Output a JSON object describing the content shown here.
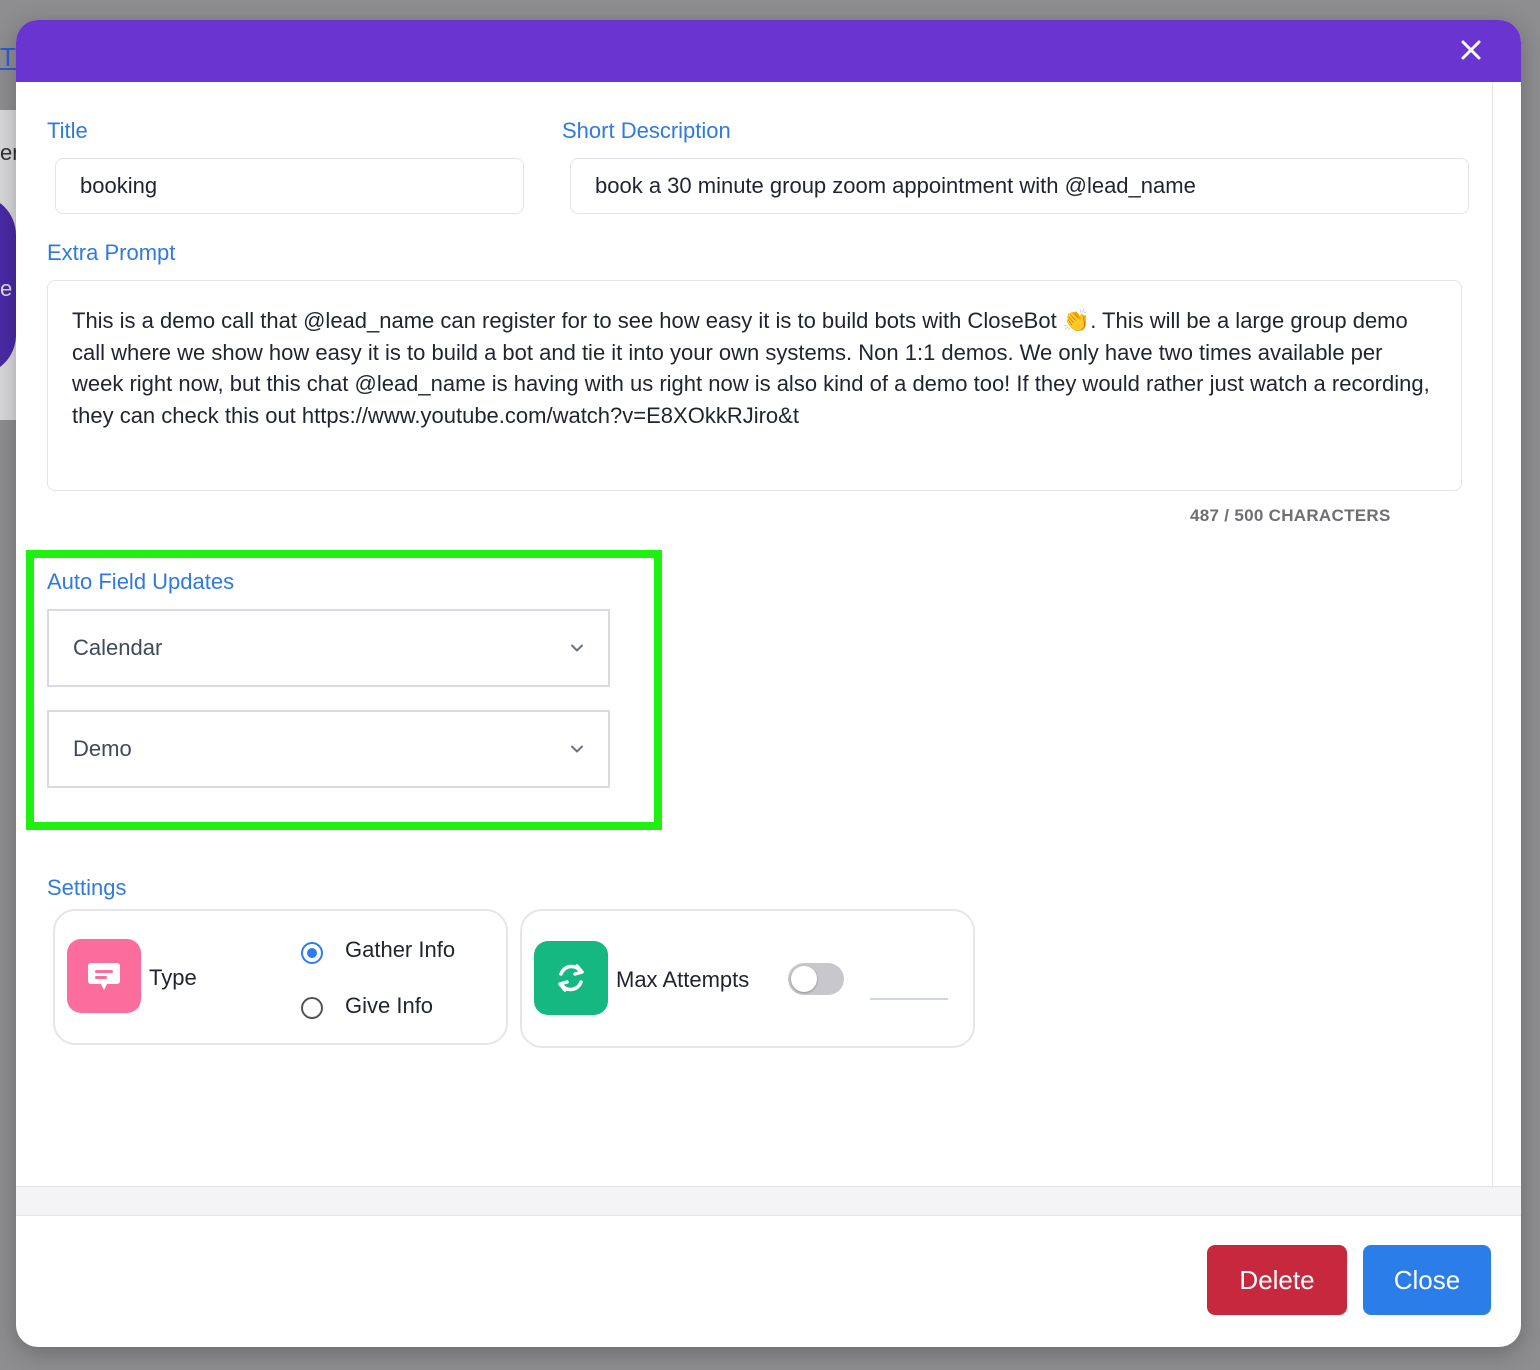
{
  "background": {
    "link_fragment": "T",
    "text_fragment_1": "er",
    "text_fragment_2": "e"
  },
  "modal": {
    "close_icon": "close-icon",
    "title_label": "Title",
    "title_value": "booking",
    "short_description_label": "Short Description",
    "short_description_value": "book a 30 minute group zoom appointment with @lead_name",
    "extra_prompt_label": "Extra Prompt",
    "extra_prompt_value": "This is a demo call that @lead_name can register for to see how easy it is to build bots with CloseBot 👏. This will be a large group demo call where we show how easy it is to build a bot and tie it into your own systems. Non 1:1 demos.  We only have two times available per week right now, but this chat @lead_name is having with us right now is also kind of a demo too!  If they would rather just watch a recording, they can check this out https://www.youtube.com/watch?v=E8XOkkRJiro&t",
    "char_count": "487 / 500 CHARACTERS",
    "auto_field_updates_label": "Auto Field Updates",
    "select_1_value": "Calendar",
    "select_2_value": "Demo",
    "settings_label": "Settings",
    "type_card": {
      "label": "Type",
      "options": [
        "Gather Info",
        "Give Info"
      ],
      "selected": "Gather Info"
    },
    "attempts_card": {
      "label": "Max Attempts",
      "toggle_on": false
    },
    "delete_button": "Delete",
    "close_button": "Close"
  },
  "colors": {
    "header": "#6a34d1",
    "label": "#2f7ae0",
    "highlight": "#1ef00f",
    "delete": "#c8283d",
    "close": "#2b7de9",
    "type_icon_bg": "#fb6d9d",
    "attempts_icon_bg": "#16b882"
  }
}
